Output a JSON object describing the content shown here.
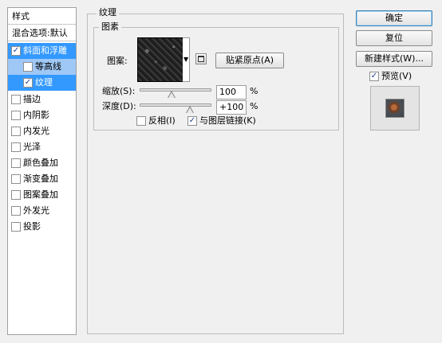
{
  "styles_panel": {
    "header": "样式",
    "blend_options": "混合选项:默认",
    "items": [
      {
        "label": "斜面和浮雕",
        "checked": true
      },
      {
        "label": "等高线",
        "checked": false
      },
      {
        "label": "纹理",
        "checked": true
      },
      {
        "label": "描边",
        "checked": false
      },
      {
        "label": "内阴影",
        "checked": false
      },
      {
        "label": "内发光",
        "checked": false
      },
      {
        "label": "光泽",
        "checked": false
      },
      {
        "label": "颜色叠加",
        "checked": false
      },
      {
        "label": "渐变叠加",
        "checked": false
      },
      {
        "label": "图案叠加",
        "checked": false
      },
      {
        "label": "外发光",
        "checked": false
      },
      {
        "label": "投影",
        "checked": false
      }
    ]
  },
  "texture": {
    "section_title": "纹理",
    "group_title": "图素",
    "pattern_label": "图案:",
    "snap_button": "贴紧原点(A)",
    "scale_label": "缩放(S):",
    "scale_value": "100",
    "scale_fraction": 0.44,
    "depth_label": "深度(D):",
    "depth_value": "+100",
    "depth_fraction": 0.7,
    "percent": "%",
    "invert_label": "反相(I)",
    "invert_checked": false,
    "link_label": "与图层链接(K)",
    "link_checked": true
  },
  "buttons": {
    "ok": "确定",
    "reset": "复位",
    "new_style": "新建样式(W)..."
  },
  "preview": {
    "label": "预览(V)",
    "checked": true
  }
}
